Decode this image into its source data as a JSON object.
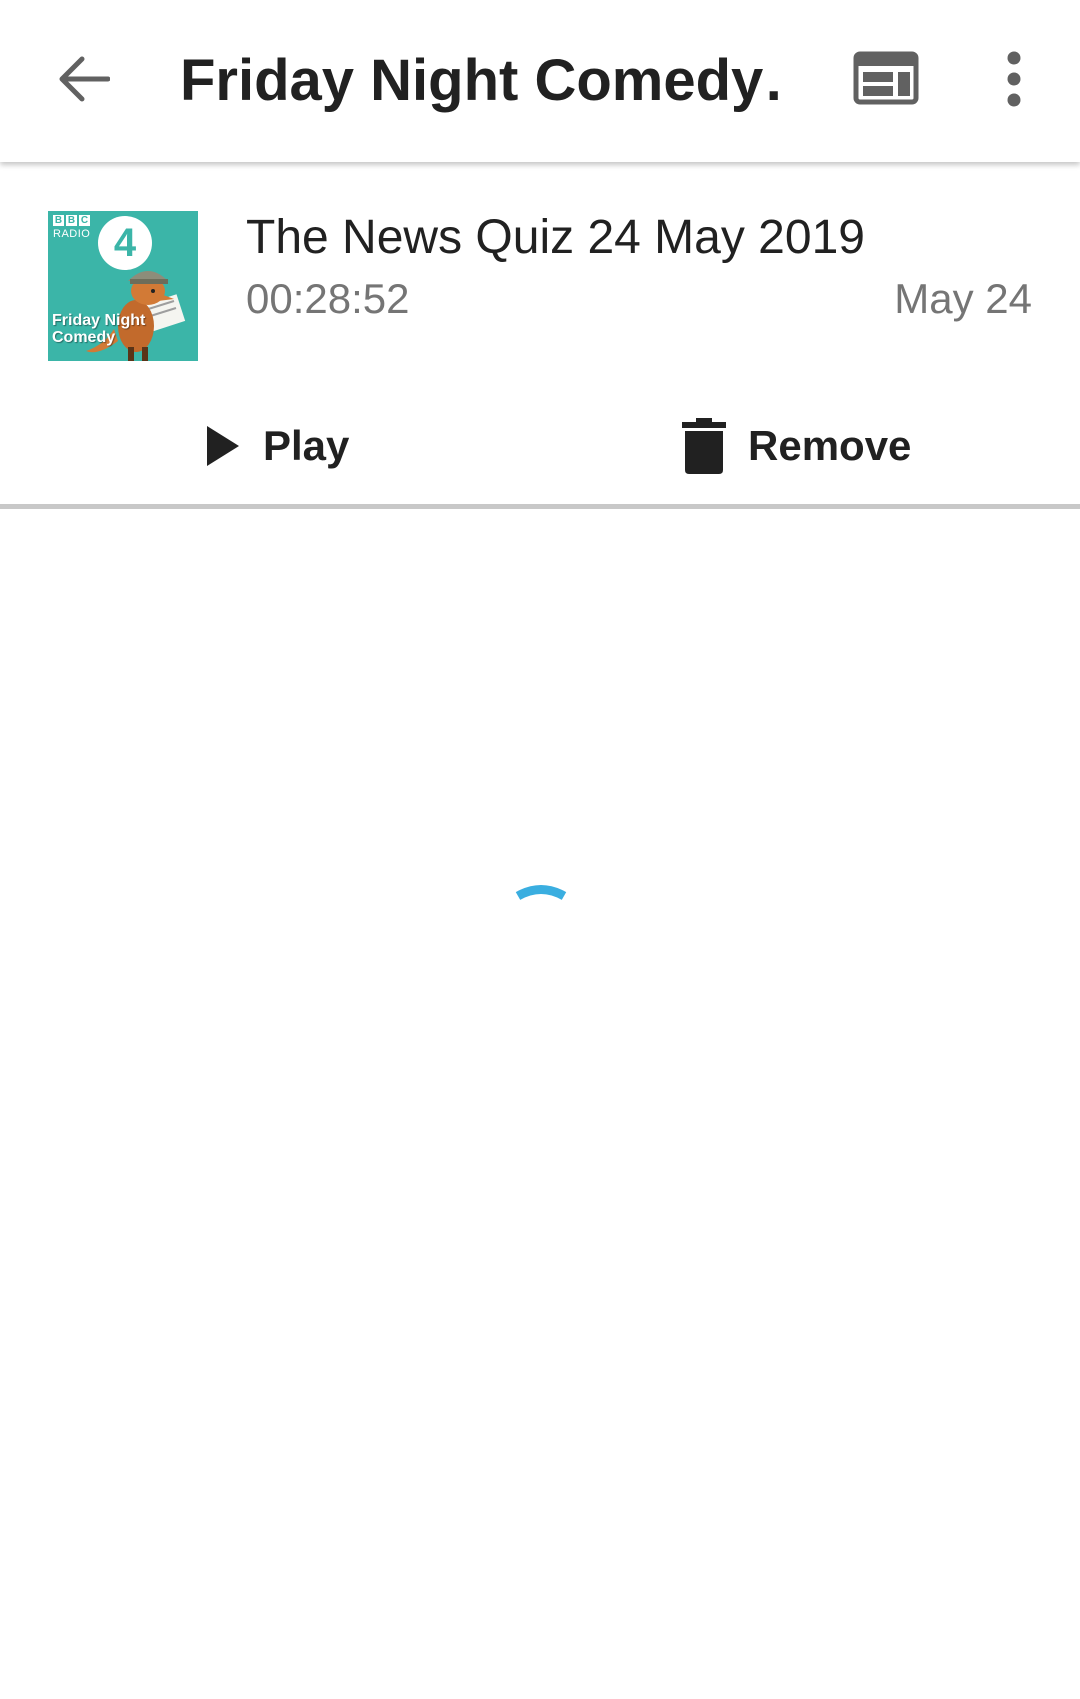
{
  "toolbar": {
    "title": "Friday Night Comedy…",
    "back_icon": "arrow-back-icon",
    "web_icon": "web-view-icon",
    "more_icon": "more-vert-icon"
  },
  "episode": {
    "artwork": {
      "bbc": [
        "B",
        "B",
        "C"
      ],
      "radio": "RADIO",
      "channel": "4",
      "show_line1": "Friday Night",
      "show_line2": "Comedy"
    },
    "title": "The News Quiz 24 May 2019",
    "duration": "00:28:52",
    "date": "May 24"
  },
  "actions": {
    "play_label": "Play",
    "play_icon": "play-icon",
    "remove_label": "Remove",
    "remove_icon": "trash-icon"
  },
  "colors": {
    "accent_spinner": "#3aaee0",
    "artwork_bg": "#3bb5a8",
    "text_primary": "#212121",
    "text_secondary": "#757575",
    "divider": "#c8c8c8"
  },
  "status": {
    "loading": true
  }
}
